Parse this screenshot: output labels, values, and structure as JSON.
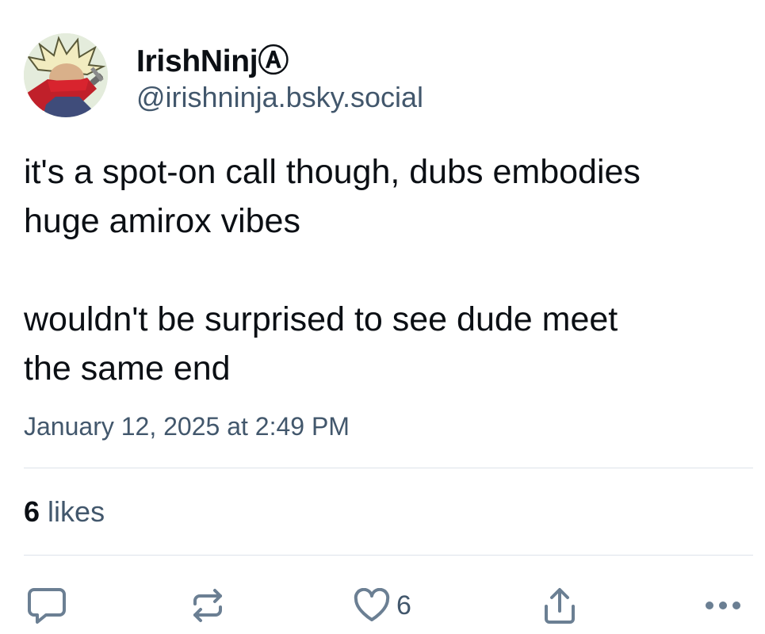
{
  "author": {
    "display_name": "IrishNinjⒶ",
    "handle": "@irishninja.bsky.social",
    "avatar_icon": "ninja-avatar"
  },
  "post": {
    "paragraphs": [
      "it's a spot-on call though, dubs embodies\nhuge amirox vibes",
      "wouldn't be surprised to see dude meet\nthe same end"
    ],
    "timestamp": "January 12, 2025 at 2:49 PM"
  },
  "stats": {
    "likes_count": "6",
    "likes_label": "likes"
  },
  "actions": {
    "reply_icon": "speech-bubble-icon",
    "repost_icon": "repost-arrows-icon",
    "like_icon": "heart-icon",
    "like_count": "6",
    "share_icon": "share-upload-icon",
    "more_icon": "ellipsis-icon"
  },
  "colors": {
    "text_primary": "#0b0f14",
    "text_secondary": "#42576c",
    "icon": "#6b7f93",
    "divider": "#dde3ea"
  }
}
